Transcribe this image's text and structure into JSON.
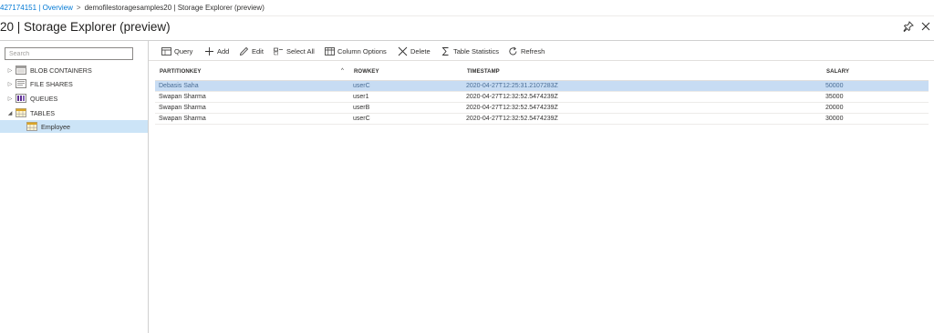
{
  "breadcrumb": {
    "items": [
      "427174151 | Overview",
      "demofilestoragesamples20 | Storage Explorer (preview)"
    ],
    "separator": ">"
  },
  "page": {
    "title": "20 | Storage Explorer (preview)"
  },
  "sidebar": {
    "search_placeholder": "Search",
    "items": [
      {
        "label": "BLOB CONTAINERS",
        "icon": "blob-container-icon",
        "expander": "▷"
      },
      {
        "label": "FILE SHARES",
        "icon": "file-share-icon",
        "expander": "▷"
      },
      {
        "label": "QUEUES",
        "icon": "queue-icon",
        "expander": "▷"
      },
      {
        "label": "TABLES",
        "icon": "table-icon",
        "expander": "◢"
      },
      {
        "label": "Employee",
        "icon": "table-item-icon",
        "expander": ""
      }
    ]
  },
  "toolbar": {
    "query": "Query",
    "add": "Add",
    "edit": "Edit",
    "select_all": "Select All",
    "column_options": "Column Options",
    "delete": "Delete",
    "table_statistics": "Table Statistics",
    "refresh": "Refresh"
  },
  "grid": {
    "columns": [
      "PARTITIONKEY",
      "ROWKEY",
      "TIMESTAMP",
      "SALARY"
    ],
    "sort_indicator": "^",
    "rows": [
      [
        "Debasis Saha",
        "userC",
        "2020-04-27T12:25:31.2107283Z",
        "50000"
      ],
      [
        "Swapan Sharma",
        "user1",
        "2020-04-27T12:32:52.5474239Z",
        "35000"
      ],
      [
        "Swapan Sharma",
        "userB",
        "2020-04-27T12:32:52.5474239Z",
        "20000"
      ],
      [
        "Swapan Sharma",
        "userC",
        "2020-04-27T12:32:52.5474239Z",
        "30000"
      ]
    ],
    "selected_row": 0
  },
  "colors": {
    "link": "#0078d4",
    "selected_tree_bg": "#cce4f7",
    "selected_row_bg": "#c7dcf3"
  }
}
